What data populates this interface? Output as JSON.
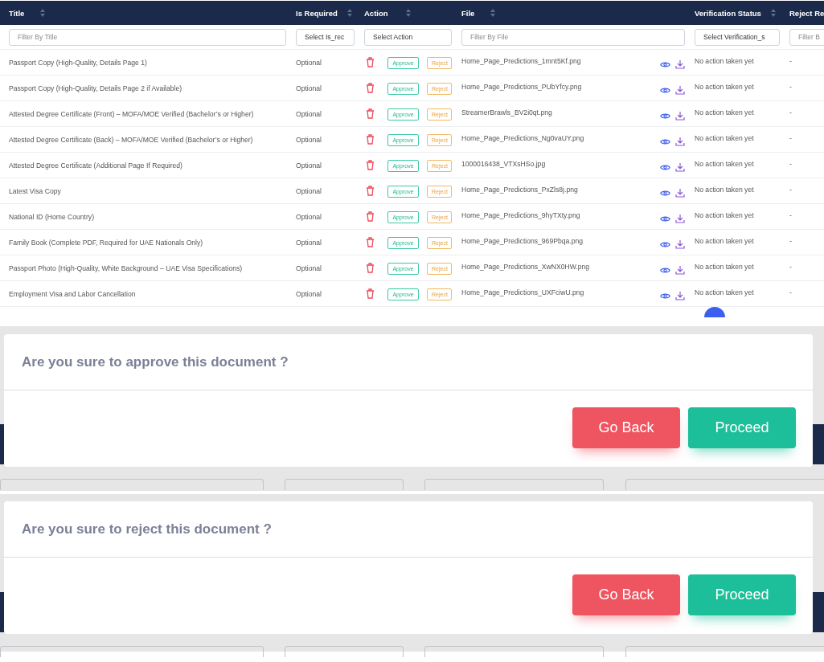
{
  "table": {
    "columns": [
      {
        "label": "Title",
        "sortable": true
      },
      {
        "label": "Is Required",
        "sortable": true
      },
      {
        "label": "Action",
        "sortable": true
      },
      {
        "label": "File",
        "sortable": true
      },
      {
        "label": "Verification Status",
        "sortable": true
      },
      {
        "label": "Reject Re",
        "sortable": false
      }
    ],
    "filters": [
      {
        "kind": "text",
        "placeholder": "Filter By Title"
      },
      {
        "kind": "select",
        "placeholder": "Select Is_rec"
      },
      {
        "kind": "select",
        "placeholder": "Select Action"
      },
      {
        "kind": "text",
        "placeholder": "Filter By File"
      },
      {
        "kind": "select",
        "placeholder": "Select Verification_s"
      },
      {
        "kind": "text",
        "placeholder": "Filter B"
      }
    ],
    "rows": [
      {
        "title": "Passport Copy (High-Quality, Details Page 1)",
        "required": "Optional",
        "approve": "Approve",
        "reject": "Reject",
        "file": "Home_Page_Predictions_1mnt5Kf.png",
        "status": "No action taken yet",
        "reject_reason": "-"
      },
      {
        "title": "Passport Copy (High-Quality, Details Page 2 if Available)",
        "required": "Optional",
        "approve": "Approve",
        "reject": "Reject",
        "file": "Home_Page_Predictions_PUbYfcy.png",
        "status": "No action taken yet",
        "reject_reason": "-"
      },
      {
        "title": "Attested Degree Certificate (Front) – MOFA/MOE Verified (Bachelor’s or Higher)",
        "required": "Optional",
        "approve": "Approve",
        "reject": "Reject",
        "file": "StreamerBrawls_BV2i0qt.png",
        "status": "No action taken yet",
        "reject_reason": "-"
      },
      {
        "title": "Attested Degree Certificate (Back) – MOFA/MOE Verified (Bachelor’s or Higher)",
        "required": "Optional",
        "approve": "Approve",
        "reject": "Reject",
        "file": "Home_Page_Predictions_Ng0vaUY.png",
        "status": "No action taken yet",
        "reject_reason": "-"
      },
      {
        "title": "Attested Degree Certificate (Additional Page If Required)",
        "required": "Optional",
        "approve": "Approve",
        "reject": "Reject",
        "file": "1000016438_VTXsHSo.jpg",
        "status": "No action taken yet",
        "reject_reason": "-"
      },
      {
        "title": "Latest Visa Copy",
        "required": "Optional",
        "approve": "Approve",
        "reject": "Reject",
        "file": "Home_Page_Predictions_PxZls8j.png",
        "status": "No action taken yet",
        "reject_reason": "-"
      },
      {
        "title": "National ID (Home Country)",
        "required": "Optional",
        "approve": "Approve",
        "reject": "Reject",
        "file": "Home_Page_Predictions_9hyTXty.png",
        "status": "No action taken yet",
        "reject_reason": "-"
      },
      {
        "title": "Family Book (Complete PDF, Required for UAE Nationals Only)",
        "required": "Optional",
        "approve": "Approve",
        "reject": "Reject",
        "file": "Home_Page_Predictions_969Pbqa.png",
        "status": "No action taken yet",
        "reject_reason": "-"
      },
      {
        "title": "Passport Photo (High-Quality, White Background – UAE Visa Specifications)",
        "required": "Optional",
        "approve": "Approve",
        "reject": "Reject",
        "file": "Home_Page_Predictions_XwNX0HW.png",
        "status": "No action taken yet",
        "reject_reason": "-"
      },
      {
        "title": "Employment Visa and Labor Cancellation",
        "required": "Optional",
        "approve": "Approve",
        "reject": "Reject",
        "file": "Home_Page_Predictions_UXFciwU.png",
        "status": "No action taken yet",
        "reject_reason": "-"
      }
    ]
  },
  "dialogs": [
    {
      "message": "Are you sure to approve this document ?",
      "buttons": [
        {
          "label": "Go Back",
          "kind": "cancel"
        },
        {
          "label": "Proceed",
          "kind": "confirm"
        }
      ]
    },
    {
      "message": "Are you sure to reject this document ?",
      "buttons": [
        {
          "label": "Go Back",
          "kind": "cancel"
        },
        {
          "label": "Proceed",
          "kind": "confirm"
        }
      ]
    }
  ]
}
